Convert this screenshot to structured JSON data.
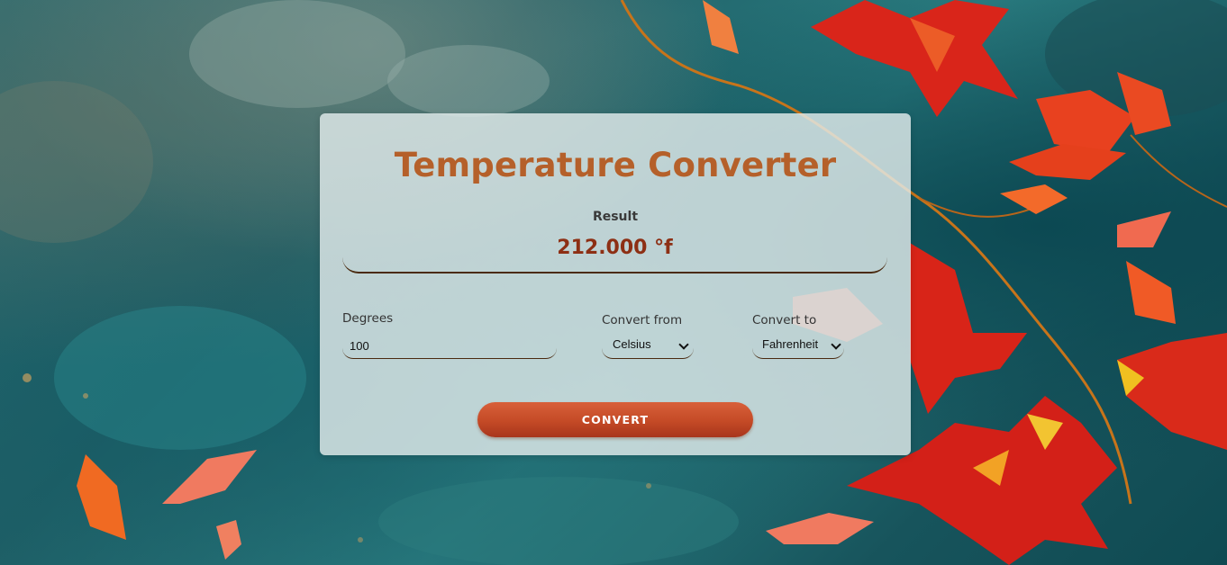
{
  "app": {
    "title": "Temperature Converter"
  },
  "result": {
    "label": "Result",
    "value": "212.000 °f"
  },
  "form": {
    "degrees_label": "Degrees",
    "degrees_value": "100",
    "from_label": "Convert from",
    "from_value": "Celsius",
    "to_label": "Convert to",
    "to_value": "Fahrenheit",
    "button_label": "CONVERT"
  },
  "colors": {
    "title": "#b5602a",
    "result_value": "#8d2f14",
    "button": "#c44a26"
  }
}
